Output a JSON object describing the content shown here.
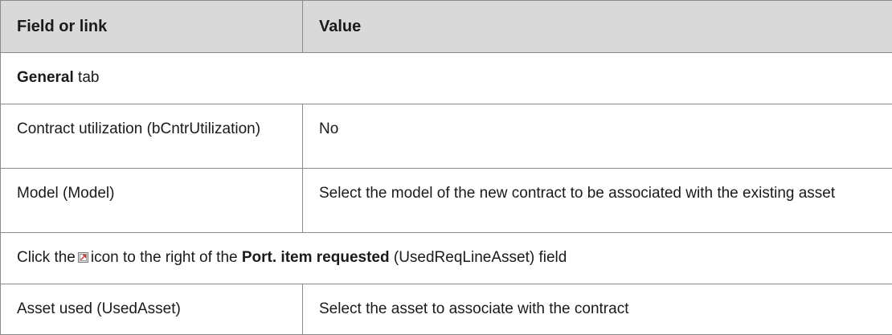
{
  "table": {
    "header": {
      "col1": "Field or link",
      "col2": "Value"
    },
    "general_row": {
      "bold": "General",
      "rest": " tab"
    },
    "rows": [
      {
        "field": "Contract utilization (bCntrUtilization)",
        "value": "No"
      },
      {
        "field": "Model (Model)",
        "value": "Select the model of the new contract to be associated with the existing asset"
      }
    ],
    "click_row": {
      "part1": "Click the",
      "icon": "open-link-icon",
      "part2": "icon to the right of the ",
      "bold": "Port. item requested",
      "part3": " (UsedReqLineAsset) field"
    },
    "last_row": {
      "field": "Asset used (UsedAsset)",
      "value": "Select the asset to associate with the contract"
    }
  },
  "colors": {
    "header_bg": "#d9d9d9",
    "border": "#8a8a8a",
    "icon_red": "#c0392b"
  }
}
